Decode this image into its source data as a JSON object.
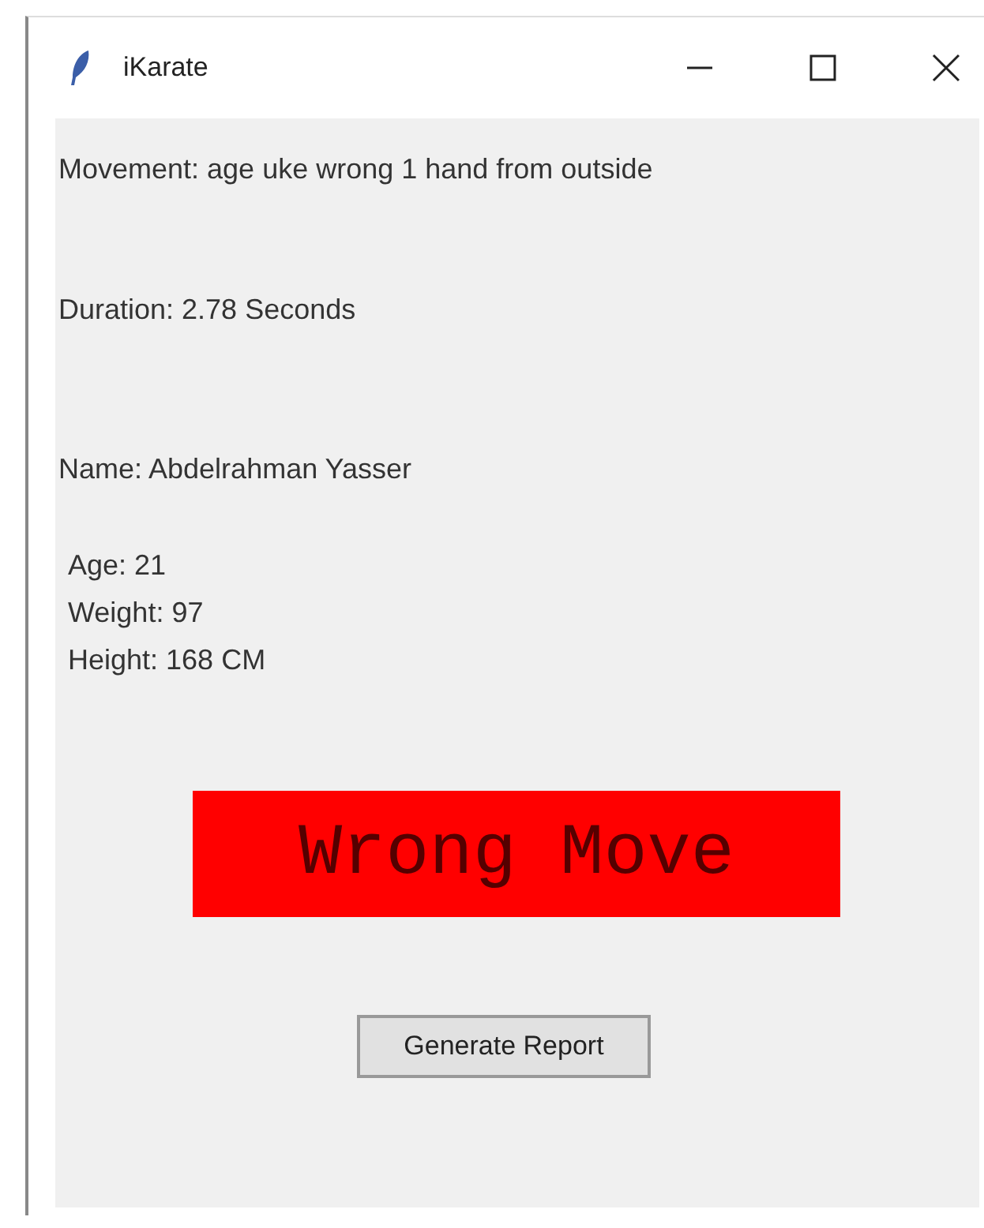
{
  "window": {
    "title": "iKarate"
  },
  "movement": "Movement: age uke wrong 1 hand from outside",
  "duration": "Duration: 2.78 Seconds",
  "name": "Name: Abdelrahman Yasser",
  "details": [
    "Age: 21",
    "Weight: 97",
    "Height: 168 CM"
  ],
  "result": {
    "text": "Wrong Move",
    "error": true
  },
  "buttons": [
    "Generate Report"
  ]
}
